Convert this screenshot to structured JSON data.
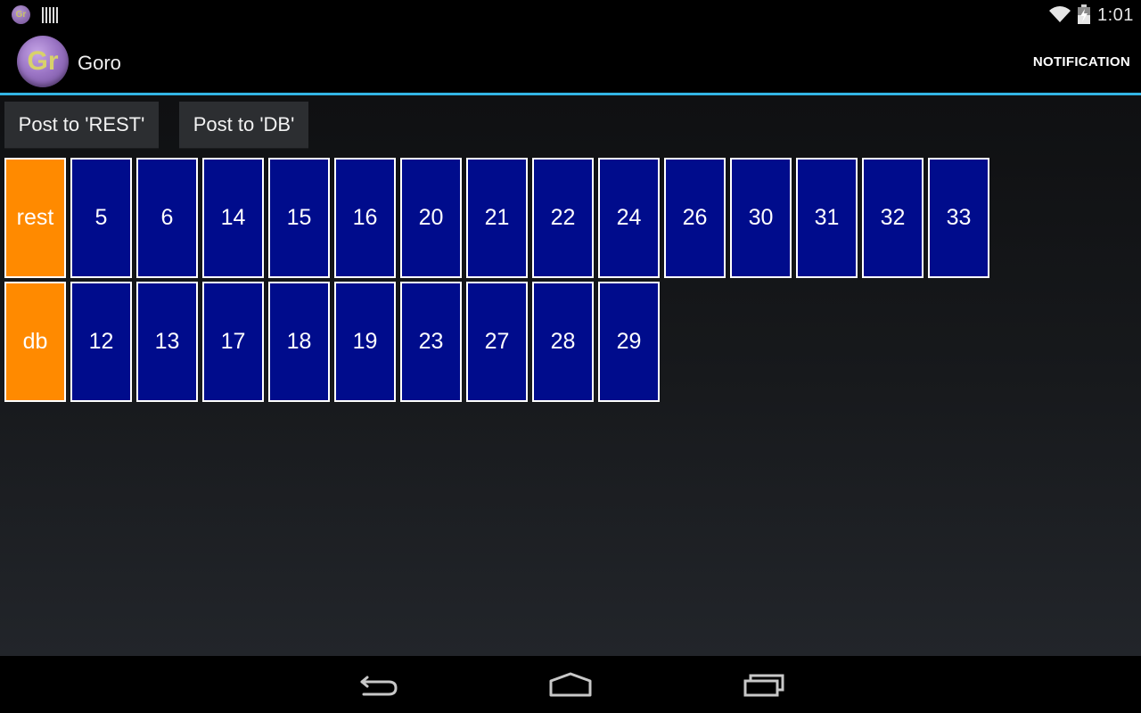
{
  "status_bar": {
    "app_icon_text": "Gr",
    "time": "1:01"
  },
  "action_bar": {
    "logo_text": "Gr",
    "title": "Goro",
    "notification_label": "NOTIFICATION"
  },
  "buttons": {
    "post_rest": "Post to 'REST'",
    "post_db": "Post to 'DB'"
  },
  "grid": {
    "rest": {
      "label": "rest",
      "items": [
        "5",
        "6",
        "14",
        "15",
        "16",
        "20",
        "21",
        "22",
        "24",
        "26",
        "30",
        "31",
        "32",
        "33"
      ]
    },
    "db": {
      "label": "db",
      "items": [
        "12",
        "13",
        "17",
        "18",
        "19",
        "23",
        "27",
        "28",
        "29"
      ]
    }
  },
  "colors": {
    "accent": "#33b5e5",
    "label_cell": "#ff8a00",
    "number_cell": "#000c8c"
  },
  "nav": {
    "icons": [
      "back-icon",
      "home-icon",
      "recents-icon"
    ]
  }
}
